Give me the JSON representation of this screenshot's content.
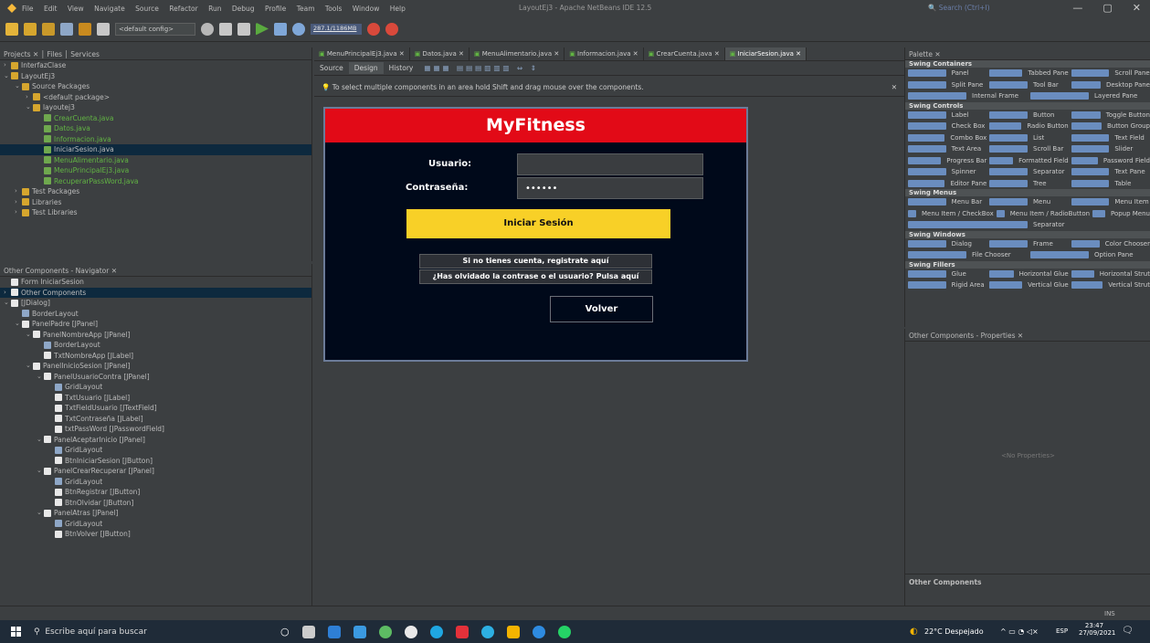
{
  "window": {
    "title": "LayoutEj3 - Apache NetBeans IDE 12.5",
    "menu": [
      "File",
      "Edit",
      "View",
      "Navigate",
      "Source",
      "Refactor",
      "Run",
      "Debug",
      "Profile",
      "Team",
      "Tools",
      "Window",
      "Help"
    ],
    "search_placeholder": "Search (Ctrl+I)",
    "controls": [
      "—",
      "▢",
      "✕"
    ]
  },
  "toolbar": {
    "config": "<default config>",
    "memory": "287.1/1186MB"
  },
  "projects": {
    "tabs": [
      "Projects",
      "Files",
      "Services"
    ],
    "tree": [
      {
        "label": "InterfazClase",
        "indent": 0,
        "arrow": "›"
      },
      {
        "label": "LayoutEj3",
        "indent": 0,
        "arrow": "⌄"
      },
      {
        "label": "Source Packages",
        "indent": 1,
        "arrow": "⌄"
      },
      {
        "label": "<default package>",
        "indent": 2,
        "arrow": "›"
      },
      {
        "label": "layoutej3",
        "indent": 2,
        "arrow": "⌄"
      },
      {
        "label": "CrearCuenta.java",
        "indent": 3,
        "arrow": "",
        "green": true
      },
      {
        "label": "Datos.java",
        "indent": 3,
        "arrow": "",
        "green": true
      },
      {
        "label": "Informacion.java",
        "indent": 3,
        "arrow": "",
        "green": true
      },
      {
        "label": "IniciarSesion.java",
        "indent": 3,
        "arrow": "",
        "selected": true
      },
      {
        "label": "MenuAlimentario.java",
        "indent": 3,
        "arrow": "",
        "green": true
      },
      {
        "label": "MenuPrincipalEj3.java",
        "indent": 3,
        "arrow": "",
        "green": true
      },
      {
        "label": "RecuperarPassWord.java",
        "indent": 3,
        "arrow": "",
        "green": true
      },
      {
        "label": "Test Packages",
        "indent": 1,
        "arrow": "›"
      },
      {
        "label": "Libraries",
        "indent": 1,
        "arrow": "›"
      },
      {
        "label": "Test Libraries",
        "indent": 1,
        "arrow": "›"
      }
    ]
  },
  "navigator": {
    "title": "Other Components - Navigator",
    "tree": [
      {
        "label": "Form IniciarSesion",
        "indent": 0,
        "arrow": ""
      },
      {
        "label": "Other Components",
        "indent": 0,
        "arrow": "›",
        "selected": true
      },
      {
        "label": "[JDialog]",
        "indent": 0,
        "arrow": "⌄"
      },
      {
        "label": "BorderLayout",
        "indent": 1,
        "arrow": ""
      },
      {
        "label": "PanelPadre [JPanel]",
        "indent": 1,
        "arrow": "⌄"
      },
      {
        "label": "PanelNombreApp [JPanel]",
        "indent": 2,
        "arrow": "⌄"
      },
      {
        "label": "BorderLayout",
        "indent": 3,
        "arrow": ""
      },
      {
        "label": "TxtNombreApp [JLabel]",
        "indent": 3,
        "arrow": ""
      },
      {
        "label": "PanelInicioSesion [JPanel]",
        "indent": 2,
        "arrow": "⌄"
      },
      {
        "label": "PanelUsuarioContra [JPanel]",
        "indent": 3,
        "arrow": "⌄"
      },
      {
        "label": "GridLayout",
        "indent": 4,
        "arrow": ""
      },
      {
        "label": "TxtUsuario [JLabel]",
        "indent": 4,
        "arrow": ""
      },
      {
        "label": "TxtFieldUsuario [JTextField]",
        "indent": 4,
        "arrow": ""
      },
      {
        "label": "TxtContraseña [JLabel]",
        "indent": 4,
        "arrow": ""
      },
      {
        "label": "txtPassWord [JPasswordField]",
        "indent": 4,
        "arrow": ""
      },
      {
        "label": "PanelAceptarInicio [JPanel]",
        "indent": 3,
        "arrow": "⌄"
      },
      {
        "label": "GridLayout",
        "indent": 4,
        "arrow": ""
      },
      {
        "label": "BtnIniciarSesion [JButton]",
        "indent": 4,
        "arrow": ""
      },
      {
        "label": "PanelCrearRecuperar [JPanel]",
        "indent": 3,
        "arrow": "⌄"
      },
      {
        "label": "GridLayout",
        "indent": 4,
        "arrow": ""
      },
      {
        "label": "BtnRegistrar [JButton]",
        "indent": 4,
        "arrow": ""
      },
      {
        "label": "BtnOlvidar [JButton]",
        "indent": 4,
        "arrow": ""
      },
      {
        "label": "PanelAtras [JPanel]",
        "indent": 3,
        "arrow": "⌄"
      },
      {
        "label": "GridLayout",
        "indent": 4,
        "arrow": ""
      },
      {
        "label": "BtnVolver [JButton]",
        "indent": 4,
        "arrow": ""
      }
    ]
  },
  "editor": {
    "tabs": [
      {
        "label": "MenuPrincipalEj3.java",
        "active": false
      },
      {
        "label": "Datos.java",
        "active": false
      },
      {
        "label": "MenuAlimentario.java",
        "active": false
      },
      {
        "label": "Informacion.java",
        "active": false
      },
      {
        "label": "CrearCuenta.java",
        "active": false
      },
      {
        "label": "IniciarSesion.java",
        "active": true
      }
    ],
    "modes": [
      "Source",
      "Design",
      "History"
    ],
    "hint": "To select multiple components in an area hold Shift and drag mouse over the components."
  },
  "form": {
    "title": "MyFitness",
    "user_label": "Usuario:",
    "pass_label": "Contraseña:",
    "pass_value": "••••••",
    "login_button": "Iniciar Sesión",
    "register_button": "Si no tienes cuenta, registrate aquí",
    "forgot_button": "¿Has olvidado la contrase o el usuario? Pulsa aquí",
    "back_button": "Volver"
  },
  "palette": {
    "title": "Palette",
    "categories": [
      {
        "name": "Swing Containers",
        "items": [
          "Panel",
          "Tabbed Pane",
          "Scroll Pane",
          "Split Pane",
          "Tool Bar",
          "Desktop Pane",
          "Internal Frame",
          "Layered Pane"
        ]
      },
      {
        "name": "Swing Controls",
        "items": [
          "Label",
          "Button",
          "Toggle Button",
          "Check Box",
          "Radio Button",
          "Button Group",
          "Combo Box",
          "List",
          "Text Field",
          "Text Area",
          "Scroll Bar",
          "Slider",
          "Progress Bar",
          "Formatted Field",
          "Password Field",
          "Spinner",
          "Separator",
          "Text Pane",
          "Editor Pane",
          "Tree",
          "Table"
        ]
      },
      {
        "name": "Swing Menus",
        "items": [
          "Menu Bar",
          "Menu",
          "Menu Item",
          "Menu Item / CheckBox",
          "Menu Item / RadioButton",
          "Popup Menu",
          "Separator"
        ]
      },
      {
        "name": "Swing Windows",
        "items": [
          "Dialog",
          "Frame",
          "Color Chooser",
          "File Chooser",
          "Option Pane"
        ]
      },
      {
        "name": "Swing Fillers",
        "items": [
          "Glue",
          "Horizontal Glue",
          "Horizontal Strut",
          "Rigid Area",
          "Vertical Glue",
          "Vertical Strut"
        ]
      }
    ]
  },
  "properties": {
    "title": "Other Components - Properties",
    "empty": "<No Properties>",
    "footer": "Other Components"
  },
  "status": {
    "mode": "INS"
  },
  "taskbar": {
    "search_placeholder": "Escribe aquí para buscar",
    "weather": "22°C  Despejado",
    "lang": "ESP",
    "time": "23:47",
    "date": "27/09/2021"
  }
}
